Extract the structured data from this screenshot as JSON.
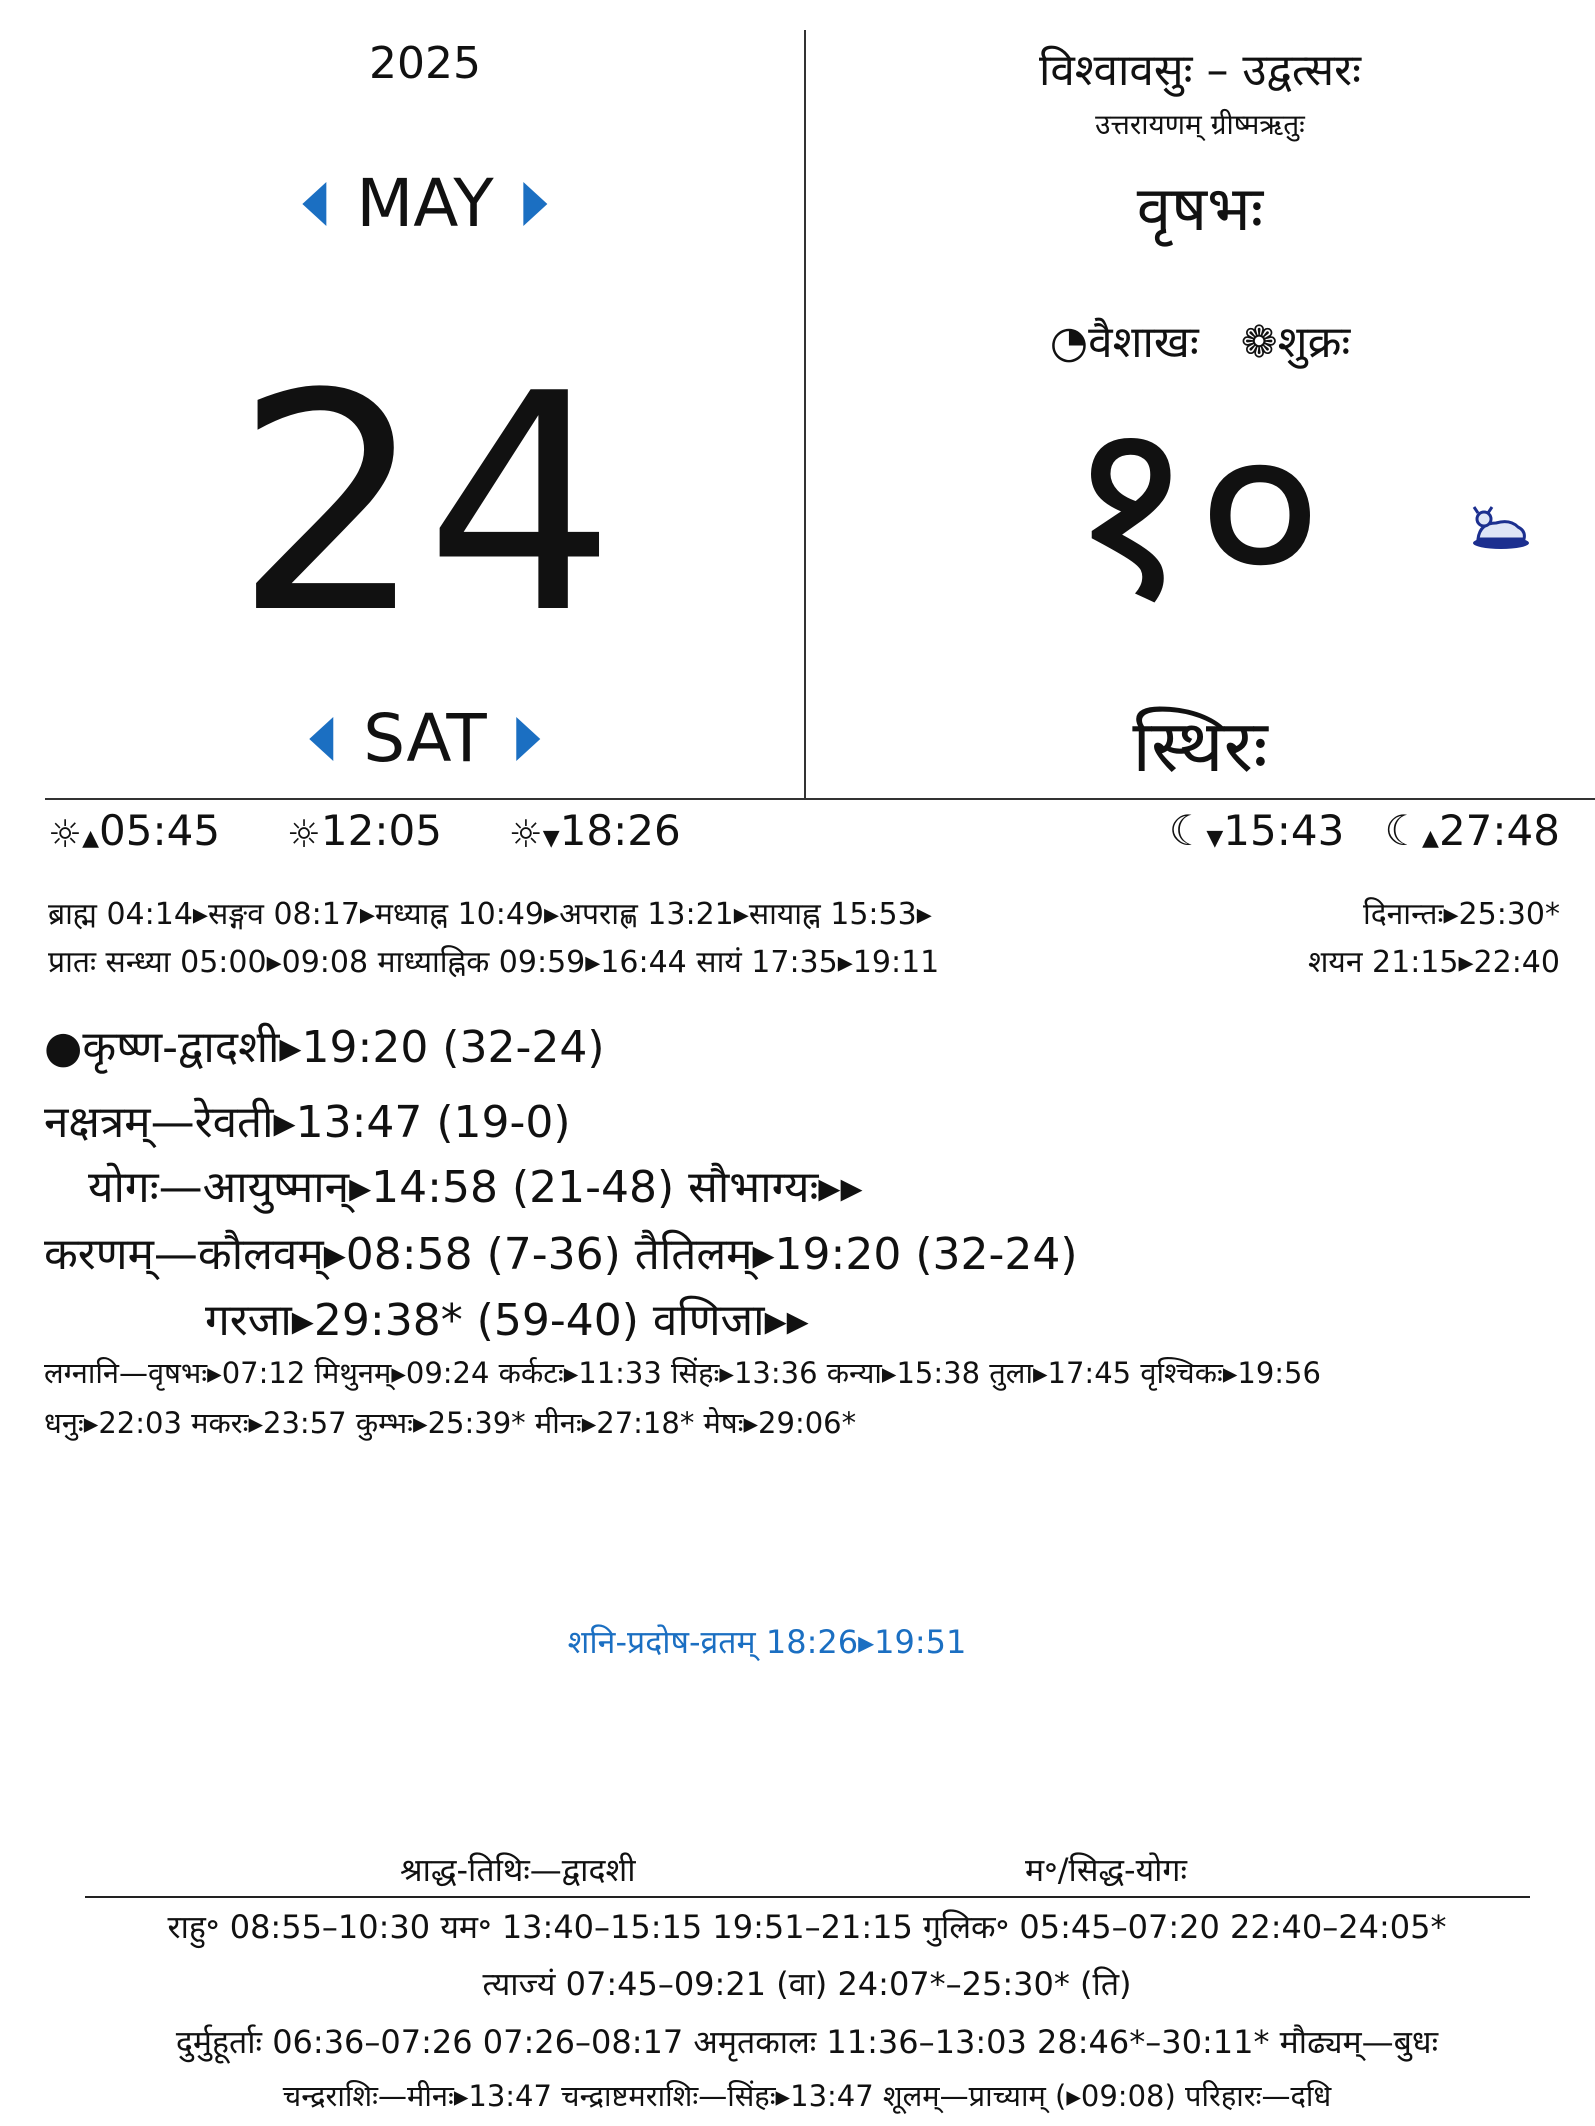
{
  "left": {
    "year": "2025",
    "month": "MAY",
    "day": "24",
    "weekday": "SAT"
  },
  "right": {
    "samvatsara": "विश्वावसुः – उद्वत्सरः",
    "ayana_ritu": "उत्तरायणम्   ग्रीष्मऋतुः",
    "rashi_month": "वृषभः",
    "lunar_month": "◔वैशाखः",
    "vara": "❁शुक्रः",
    "day_number": "१०",
    "vasara": "स्थिरः"
  },
  "sun": {
    "sunrise": "05:45",
    "noon": "12:05",
    "sunset": "18:26"
  },
  "moon": {
    "moonset": "15:43",
    "moonrise": "27:48"
  },
  "kala": {
    "line1": "ब्राह्म 04:14▸सङ्गव 08:17▸मध्याह्न 10:49▸अपराह्ण 13:21▸सायाह्न 15:53▸",
    "dinanta": "दिनान्तः▸25:30*",
    "line2": "प्रातः  सन्ध्या  05:00▸09:08  माध्याह्निक  09:59▸16:44  सायं  17:35▸19:11",
    "shayana": "शयन  21:15▸22:40"
  },
  "panchanga": {
    "tithi": "कृष्ण-द्वादशी▸19:20 (32-24)",
    "nakshatra": "नक्षत्रम्—रेवती▸13:47 (19-0)",
    "yoga": "योगः—आयुष्मान्▸14:58 (21-48)  सौभाग्यः▸▸",
    "karana1": "करणम्—कौलवम्▸08:58 (7-36)  तैतिलम्▸19:20 (32-24)",
    "karana2": "गरजा▸29:38* (59-40)  वणिजा▸▸",
    "lagna1": "लग्नानि—वृषभः▸07:12  मिथुनम्▸09:24  कर्कटः▸11:33  सिंहः▸13:36  कन्या▸15:38  तुला▸17:45  वृश्चिकः▸19:56",
    "lagna2": "धनुः▸22:03  मकरः▸23:57  कुम्भः▸25:39*  मीनः▸27:18*  मेषः▸29:06*"
  },
  "festival": "शनि-प्रदोष-व्रतम्  18:26▸19:51",
  "footer": {
    "shraddha": "श्राद्ध-तिथिः—द्वादशी",
    "siddha": "म॰/सिद्ध-योगः",
    "rahu": "राहु॰  08:55–10:30    यम॰  13:40–15:15  19:51–21:15    गुलिक॰  05:45–07:20  22:40–24:05*",
    "tyajya": "त्याज्यं  07:45–09:21 (वा)  24:07*–25:30* (ति)",
    "durmuhurta": "दुर्मुहूर्ताः  06:36–07:26    07:26–08:17  अमृतकालः  11:36–13:03    28:46*–30:11*      मौढ्यम्—बुधः",
    "chandra": "चन्द्रराशिः—मीनः▸13:47       चन्द्राष्टमराशिः—सिंहः▸13:47       शूलम्—प्राच्याम्  (▸09:08) परिहारः—दधि"
  },
  "colors": {
    "accent": "#1b6fc2",
    "text": "#111111"
  }
}
